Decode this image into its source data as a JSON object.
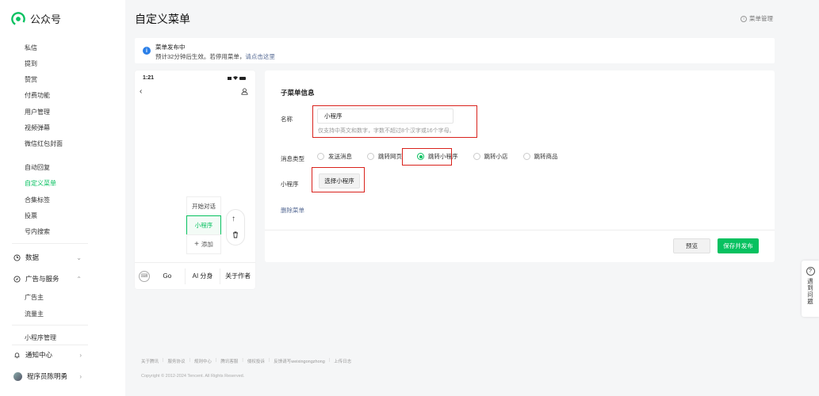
{
  "app": {
    "name": "公众号",
    "brand_color": "#07c160"
  },
  "sidebar": {
    "items": [
      {
        "label": "私信"
      },
      {
        "label": "提到"
      },
      {
        "label": "赞赏"
      },
      {
        "label": "付费功能"
      },
      {
        "label": "用户管理"
      },
      {
        "label": "视频弹幕"
      },
      {
        "label": "微信红包封面"
      },
      {
        "label": "自动回复"
      },
      {
        "label": "自定义菜单",
        "active": true
      },
      {
        "label": "合集标签"
      },
      {
        "label": "投票"
      },
      {
        "label": "号内搜索"
      }
    ],
    "groups": {
      "data": {
        "label": "数据",
        "icon": "clock-icon"
      },
      "ads": {
        "label": "广告与服务",
        "icon": "compass-icon"
      },
      "notifications": {
        "label": "通知中心",
        "icon": "bell-icon"
      },
      "account": {
        "label": "程序员陈明勇",
        "icon": "avatar"
      }
    },
    "ads_items": [
      {
        "label": "广告主"
      },
      {
        "label": "流量主"
      },
      {
        "label": "小程序管理"
      }
    ]
  },
  "header": {
    "title": "自定义菜单",
    "menu_manage_link": "菜单管理"
  },
  "notice": {
    "title": "菜单发布中",
    "desc": "预计32分钟后生效。若停用菜单，",
    "link": "请点击这里"
  },
  "phone": {
    "time": "1:21",
    "submenu": [
      "开始对话",
      "小程序"
    ],
    "add_label": "添加",
    "bottom_menus": [
      "Go",
      "AI 分身",
      "关于作者"
    ]
  },
  "editor": {
    "section_title": "子菜单信息",
    "name_label": "名称",
    "name_value": "小程序",
    "name_hint": "仅支持中英文和数字，字数不超过8个汉字或16个字母。",
    "msg_type_label": "消息类型",
    "msg_types": [
      {
        "label": "发送消息",
        "checked": false
      },
      {
        "label": "跳转网页",
        "checked": false
      },
      {
        "label": "跳转小程序",
        "checked": true
      },
      {
        "label": "跳转小店",
        "checked": false
      },
      {
        "label": "跳转商品",
        "checked": false
      }
    ],
    "mini_program_label": "小程序",
    "choose_button": "选择小程序",
    "delete_link": "删除菜单",
    "preview_button": "预览",
    "publish_button": "保存并发布"
  },
  "footer": {
    "links": [
      "关于腾讯",
      "服务协议",
      "规则中心",
      "腾讯客服",
      "侵权投诉",
      "反馈请写weixingongzhong",
      "上传日志"
    ],
    "copyright": "Copyright © 2012-2024 Tencent. All Rights Reserved."
  },
  "help": {
    "label": "遇到问题"
  },
  "colors": {
    "accent": "#07c160",
    "highlight_box": "#d9221c",
    "link": "#576b95",
    "info": "#2b7fe8"
  }
}
